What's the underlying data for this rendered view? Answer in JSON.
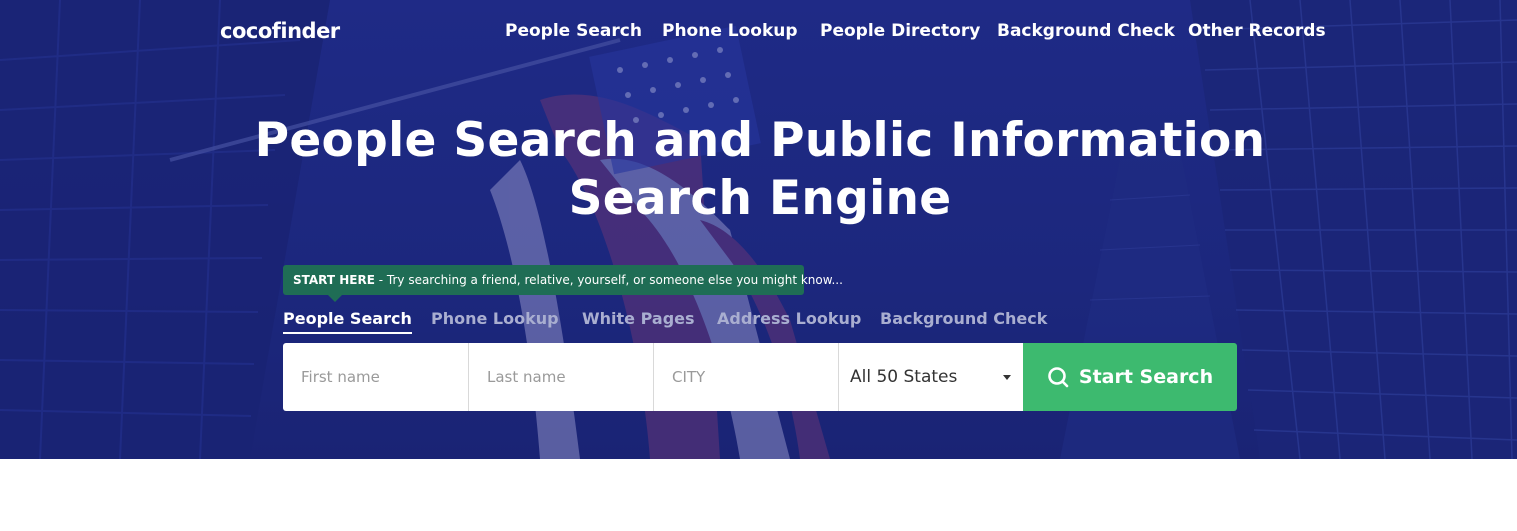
{
  "brand": {
    "logo_text": "cocofinder"
  },
  "nav": {
    "items": [
      {
        "label": "People Search"
      },
      {
        "label": "Phone Lookup"
      },
      {
        "label": "People Directory"
      },
      {
        "label": "Background Check"
      },
      {
        "label": "Other Records"
      }
    ]
  },
  "hero": {
    "headline_line1": "People Search and Public Information",
    "headline_line2": "Search Engine"
  },
  "tip": {
    "strong": "START HERE",
    "text": " - Try searching a friend, relative, yourself, or someone else you might know..."
  },
  "tabs": [
    {
      "label": "People Search",
      "active": true
    },
    {
      "label": "Phone Lookup",
      "active": false
    },
    {
      "label": "White Pages",
      "active": false
    },
    {
      "label": "Address Lookup",
      "active": false
    },
    {
      "label": "Background Check",
      "active": false
    }
  ],
  "form": {
    "first_name_placeholder": "First name",
    "last_name_placeholder": "Last name",
    "city_placeholder": "CITY",
    "state_selected": "All 50 States",
    "submit_label": "Start Search",
    "submit_icon": "search-icon"
  },
  "colors": {
    "hero_bg": "#1f2a86",
    "tip_bg": "#1f6d55",
    "button_bg": "#3dba6f"
  }
}
